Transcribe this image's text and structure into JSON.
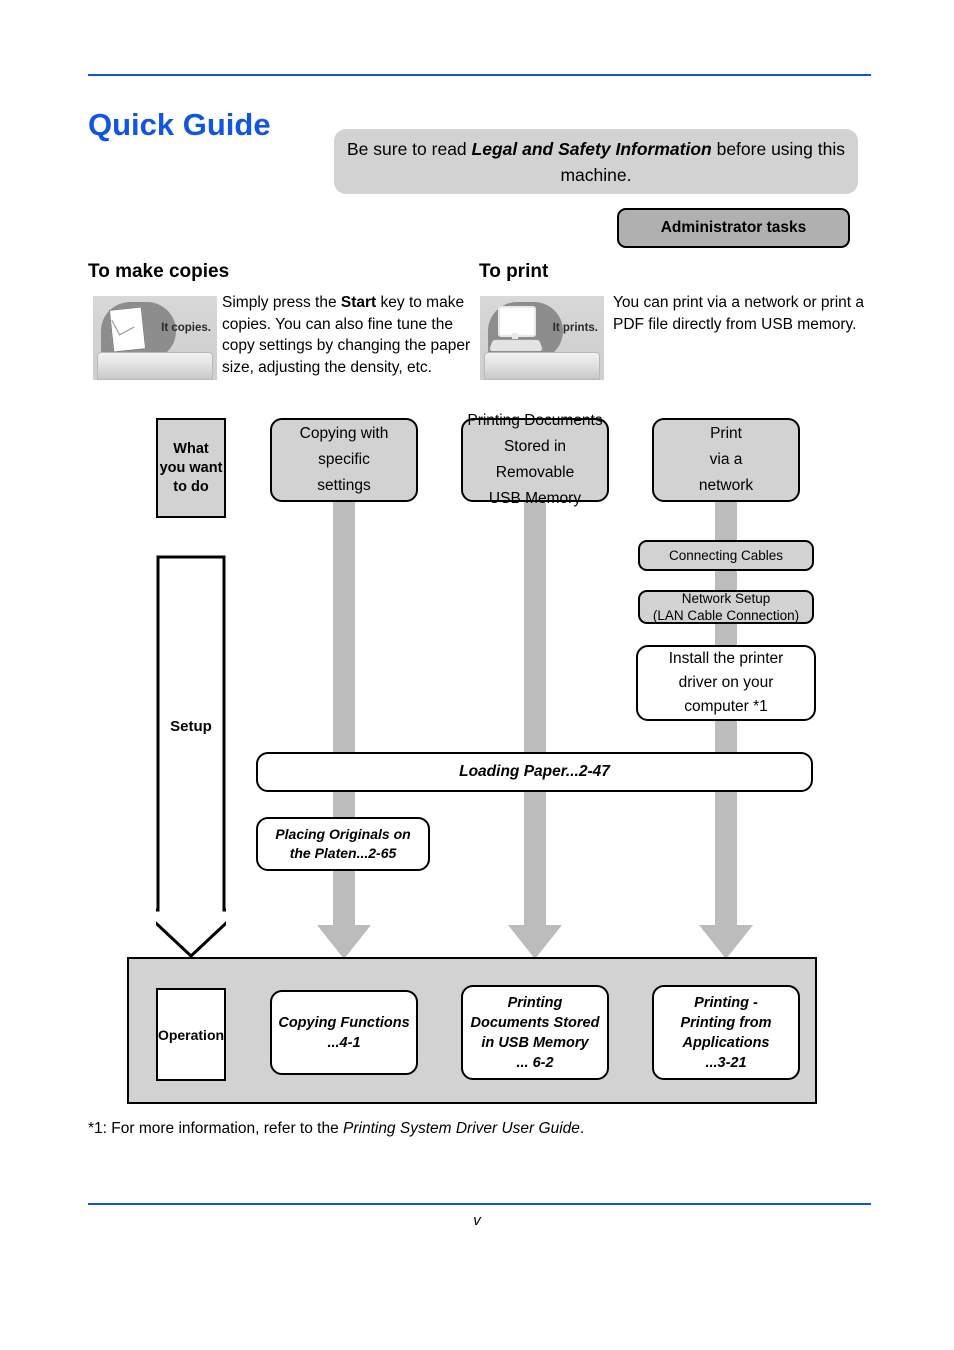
{
  "header": {
    "title": "Quick Guide",
    "notice_prefix": "Be sure to read ",
    "notice_emphasis": "Legal and Safety Information",
    "notice_suffix": " before using this machine.",
    "admin_button": "Administrator tasks",
    "title_color": "#1155e0",
    "rule_color": "#1155cc"
  },
  "sections": {
    "copies": {
      "heading": "To make copies",
      "illustration_label": "It copies.",
      "body_prefix": "Simply press the ",
      "body_bold": "Start",
      "body_suffix": " key to make copies. You can also fine tune the copy settings by changing the paper size, adjusting the density, etc."
    },
    "print": {
      "heading": "To print",
      "illustration_label": "It prints.",
      "body": "You can print via a network or print a PDF file directly from USB memory."
    }
  },
  "flow": {
    "row_labels": {
      "want": "What\nyou want\nto do",
      "want_line1": "What",
      "want_line2": "you want",
      "want_line3": "to do",
      "setup": "Setup",
      "operation": "Operation"
    },
    "goals": [
      {
        "id": "copying-with-specific-settings",
        "line1": "Copying with",
        "line2": "specific",
        "line3": "settings"
      },
      {
        "id": "printing-documents-usb",
        "line1": "Printing Documents",
        "line2": "Stored in Removable",
        "line3": "USB Memory"
      },
      {
        "id": "print-via-network",
        "line1": "Print",
        "line2": "via a",
        "line3": "network"
      }
    ],
    "setup_steps": {
      "connecting_cables": "Connecting Cables",
      "network_setup_line1": "Network Setup",
      "network_setup_line2": "(LAN Cable Connection)",
      "install_driver_line1": "Install the printer",
      "install_driver_line2": "driver on your",
      "install_driver_line3": "computer   *1",
      "loading_paper": "Loading Paper...2-47",
      "placing_originals_line1": "Placing Originals on",
      "placing_originals_line2": "the Platen...2-65"
    },
    "operations": [
      {
        "id": "copying-functions",
        "line1": "Copying Functions",
        "line2": "...4-1",
        "line3": "",
        "line4": ""
      },
      {
        "id": "printing-documents-in-usb-memory",
        "line1": "Printing",
        "line2": "Documents Stored",
        "line3": "in USB Memory",
        "line4": "... 6-2"
      },
      {
        "id": "printing-from-applications",
        "line1": "Printing -",
        "line2": "Printing from",
        "line3": "Applications",
        "line4": "...3-21"
      }
    ]
  },
  "footnote": {
    "prefix": "*1: For more information, refer to the ",
    "emphasis": "Printing System Driver User Guide",
    "suffix": "."
  },
  "folio": "v",
  "colors": {
    "box_gray": "#d2d2d2",
    "connector_gray": "#bcbcbc",
    "button_gray": "#b0b0b0"
  }
}
